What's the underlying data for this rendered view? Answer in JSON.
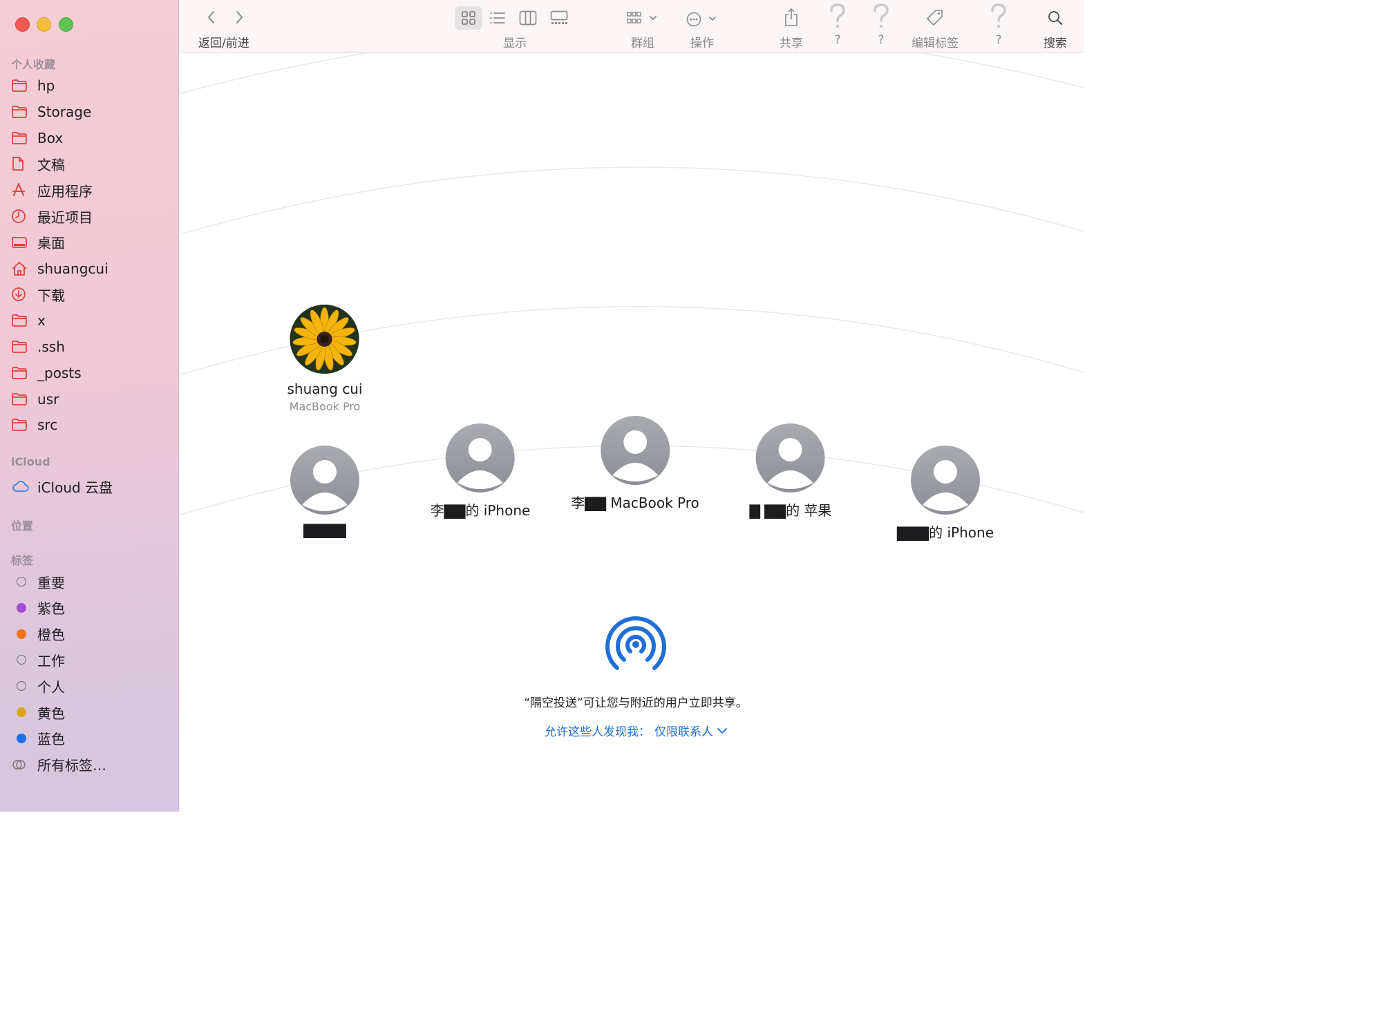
{
  "window": {
    "traffic_lights": [
      "close",
      "minimize",
      "maximize"
    ]
  },
  "sidebar": {
    "favorites_title": "个人收藏",
    "favorites": [
      {
        "label": "hp",
        "icon": "folder-icon"
      },
      {
        "label": "Storage",
        "icon": "folder-icon"
      },
      {
        "label": "Box",
        "icon": "folder-icon"
      },
      {
        "label": "文稿",
        "icon": "document-icon"
      },
      {
        "label": "应用程序",
        "icon": "applications-icon"
      },
      {
        "label": "最近项目",
        "icon": "clock-icon"
      },
      {
        "label": "桌面",
        "icon": "desktop-icon"
      },
      {
        "label": "shuangcui",
        "icon": "home-icon"
      },
      {
        "label": "下载",
        "icon": "download-icon"
      },
      {
        "label": "x",
        "icon": "folder-icon"
      },
      {
        "label": ".ssh",
        "icon": "folder-icon"
      },
      {
        "label": "_posts",
        "icon": "folder-icon"
      },
      {
        "label": "usr",
        "icon": "folder-icon"
      },
      {
        "label": "src",
        "icon": "folder-icon"
      }
    ],
    "icloud_title": "iCloud",
    "icloud": [
      {
        "label": "iCloud 云盘",
        "icon": "cloud-icon"
      }
    ],
    "locations_title": "位置",
    "tags_title": "标签",
    "tags": [
      {
        "label": "重要",
        "color": "none"
      },
      {
        "label": "紫色",
        "color": "#a24bd1"
      },
      {
        "label": "橙色",
        "color": "#f07613"
      },
      {
        "label": "工作",
        "color": "none"
      },
      {
        "label": "个人",
        "color": "none"
      },
      {
        "label": "黄色",
        "color": "#d9a514"
      },
      {
        "label": "蓝色",
        "color": "#1e6fe8"
      },
      {
        "label": "所有标签…",
        "color": "all"
      }
    ]
  },
  "toolbar": {
    "nav_label": "返回/前进",
    "view_label": "显示",
    "group_label": "群组",
    "action_label": "操作",
    "share_label": "共享",
    "help1_label": "?",
    "help2_label": "?",
    "tag_label": "编辑标签",
    "help3_label": "?",
    "search_label": "搜索"
  },
  "airdrop": {
    "me": {
      "name": "shuang cui",
      "device": "MacBook Pro"
    },
    "others": [
      {
        "name": "▇▇▇▇"
      },
      {
        "name": "李▇▇的 iPhone"
      },
      {
        "name": "李▇▇ MacBook Pro"
      },
      {
        "name": "▇ ▇▇的 苹果"
      },
      {
        "name": "▇▇▇的 iPhone"
      }
    ],
    "message": "“隔空投送”可让您与附近的用户立即共享。",
    "discover_label": "允许这些人发现我：",
    "discover_value": "仅限联系人"
  },
  "colors": {
    "accent": "#1a6fd6",
    "sidebar_icon": "#e0413a"
  }
}
